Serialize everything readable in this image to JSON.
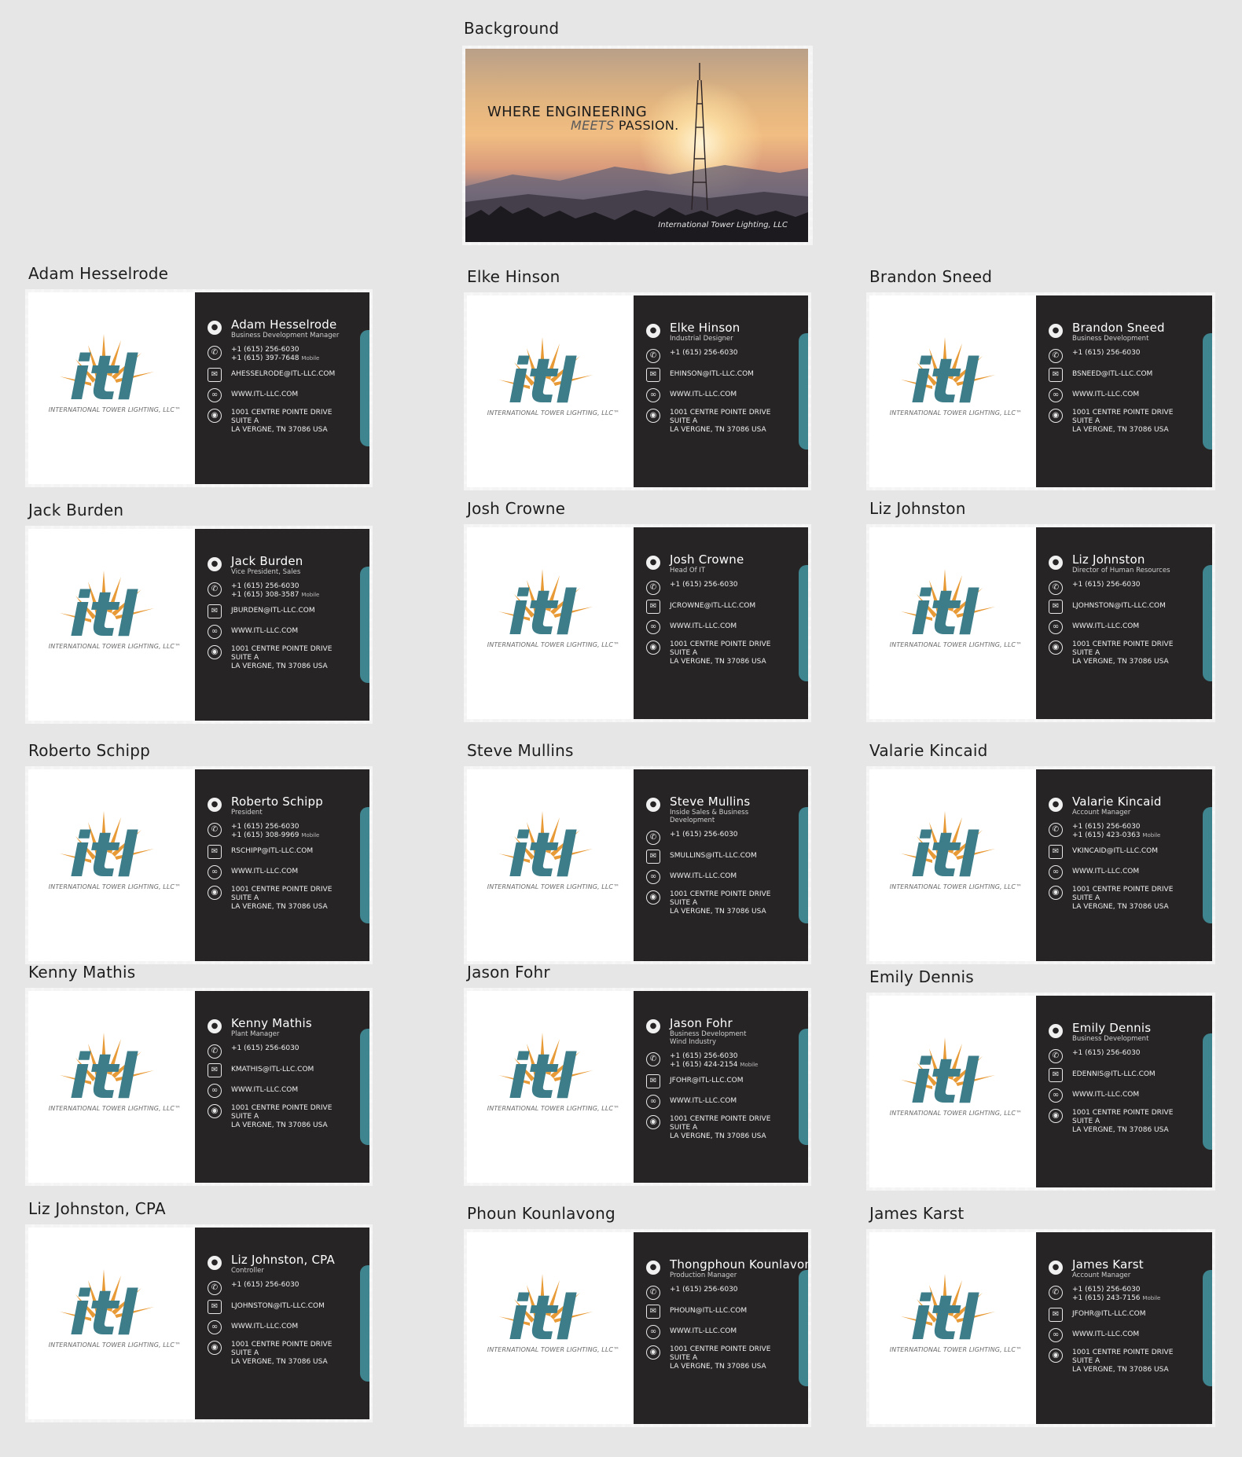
{
  "background_artboard": {
    "label": "Background",
    "headline_line1": "WHERE ENGINEERING",
    "headline_line2_italic": "MEETS",
    "headline_line2_bold": "PASSION.",
    "caption": "International Tower Lighting, LLC"
  },
  "company": {
    "logo_text": "itl",
    "tagline": "INTERNATIONAL TOWER LIGHTING, LLC™",
    "website": "WWW.ITL-LLC.COM",
    "address_line1": "1001 CENTRE POINTE DRIVE",
    "address_line2": "SUITE A",
    "address_line3": "LA VERGNE, TN 37086 USA",
    "office_phone": "+1 (615) 256-6030"
  },
  "colors": {
    "accent": "#3f8590",
    "dark_panel": "#262424",
    "logo_blue": "#3c7d89",
    "logo_orange": "#e89a36",
    "canvas": "#e6e6e6"
  },
  "cards": [
    {
      "label": "Adam Hesselrode",
      "name": "Adam Hesselrode",
      "title": [
        "Business Development Manager"
      ],
      "mobile": "+1 (615) 397-7648",
      "mobile_label": "Mobile",
      "email": "AHESSELRODE@ITL-LLC.COM"
    },
    {
      "label": "Elke Hinson",
      "name": "Elke Hinson",
      "title": [
        "Industrial Designer"
      ],
      "mobile": "",
      "mobile_label": "",
      "email": "EHINSON@ITL-LLC.COM"
    },
    {
      "label": "Brandon Sneed",
      "name": "Brandon Sneed",
      "title": [
        "Business Development"
      ],
      "mobile": "",
      "mobile_label": "",
      "email": "BSNEED@ITL-LLC.COM"
    },
    {
      "label": "Jack Burden",
      "name": "Jack Burden",
      "title": [
        "Vice President, Sales"
      ],
      "mobile": "+1 (615) 308-3587",
      "mobile_label": "Mobile",
      "email": "JBURDEN@ITL-LLC.COM"
    },
    {
      "label": "Josh Crowne",
      "name": "Josh Crowne",
      "title": [
        "Head Of IT"
      ],
      "mobile": "",
      "mobile_label": "",
      "email": "JCROWNE@ITL-LLC.COM"
    },
    {
      "label": "Liz Johnston",
      "name": "Liz Johnston",
      "title": [
        "Director of Human Resources"
      ],
      "mobile": "",
      "mobile_label": "",
      "email": "LJOHNSTON@ITL-LLC.COM"
    },
    {
      "label": "Roberto Schipp",
      "name": "Roberto Schipp",
      "title": [
        "President"
      ],
      "mobile": "+1 (615) 308-9969",
      "mobile_label": "Mobile",
      "email": "RSCHIPP@ITL-LLC.COM"
    },
    {
      "label": "Steve Mullins",
      "name": "Steve Mullins",
      "title": [
        "Inside Sales & Business",
        "Development"
      ],
      "mobile": "",
      "mobile_label": "",
      "email": "SMULLINS@ITL-LLC.COM"
    },
    {
      "label": "Valarie Kincaid",
      "name": "Valarie Kincaid",
      "title": [
        "Account Manager"
      ],
      "mobile": "+1 (615) 423-0363",
      "mobile_label": "Mobile",
      "email": "VKINCAID@ITL-LLC.COM"
    },
    {
      "label": "Kenny Mathis",
      "name": "Kenny Mathis",
      "title": [
        "Plant Manager"
      ],
      "mobile": "",
      "mobile_label": "",
      "email": "KMATHIS@ITL-LLC.COM"
    },
    {
      "label": "Jason Fohr",
      "name": "Jason Fohr",
      "title": [
        "Business Development",
        "Wind Industry"
      ],
      "mobile": "+1 (615) 424-2154",
      "mobile_label": "Mobile",
      "email": "JFOHR@ITL-LLC.COM"
    },
    {
      "label": "Emily Dennis",
      "name": "Emily Dennis",
      "title": [
        "Business Development"
      ],
      "mobile": "",
      "mobile_label": "",
      "email": "EDENNIS@ITL-LLC.COM"
    },
    {
      "label": "Liz Johnston, CPA",
      "name": "Liz Johnston, CPA",
      "title": [
        "Controller"
      ],
      "mobile": "",
      "mobile_label": "",
      "email": "LJOHNSTON@ITL-LLC.COM"
    },
    {
      "label": "Phoun Kounlavong",
      "name": "Thongphoun Kounlavong",
      "title": [
        "Production Manager"
      ],
      "mobile": "",
      "mobile_label": "",
      "email": "PHOUN@ITL-LLC.COM"
    },
    {
      "label": "James Karst",
      "name": "James Karst",
      "title": [
        "Account Manager"
      ],
      "mobile": "+1 (615) 243-7156",
      "mobile_label": "Mobile",
      "email": "JFOHR@ITL-LLC.COM"
    }
  ]
}
